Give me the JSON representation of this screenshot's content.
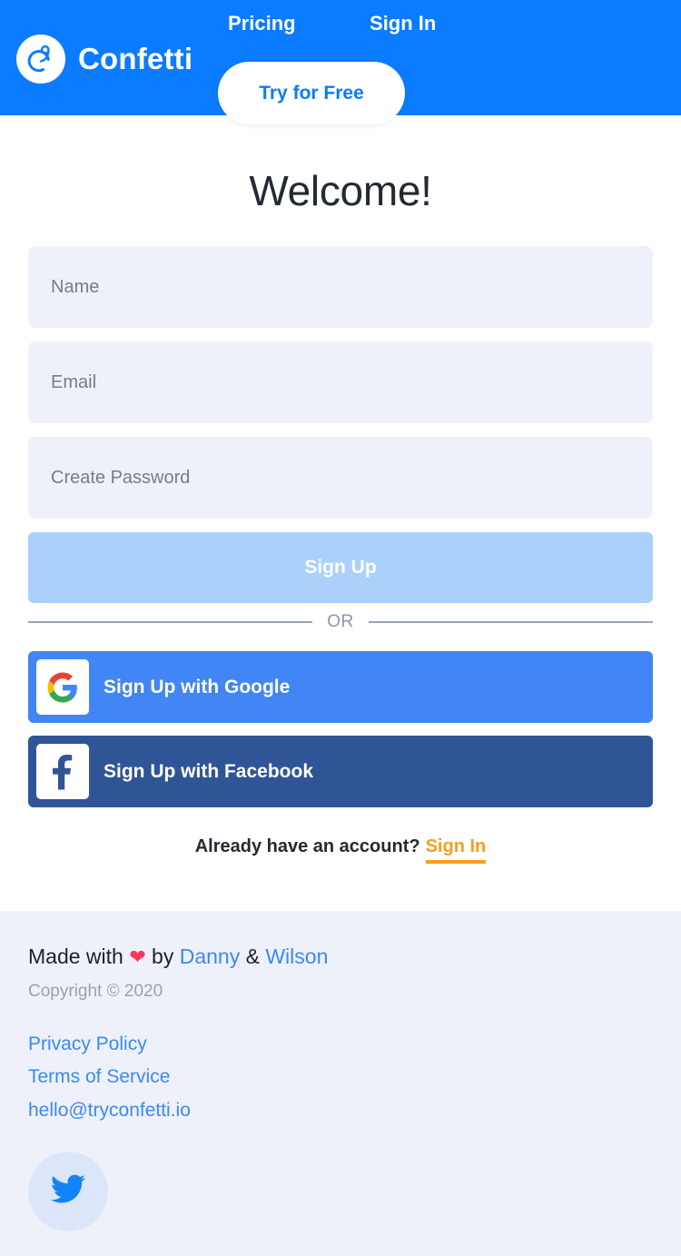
{
  "header": {
    "brand_name": "Confetti",
    "brand_logo_icon": "confetti-swirl-icon",
    "nav": [
      {
        "label": "Pricing",
        "name": "pricing"
      },
      {
        "label": "Sign In",
        "name": "sign-in"
      }
    ],
    "cta_label": "Try for Free",
    "background_color": "#0b7bff",
    "cta_text_color": "#0b7bff"
  },
  "main": {
    "title": "Welcome!",
    "fields": [
      {
        "placeholder": "Name",
        "value": "",
        "type": "text"
      },
      {
        "placeholder": "Email",
        "value": "",
        "type": "email"
      },
      {
        "placeholder": "Create Password",
        "value": "",
        "type": "password"
      }
    ],
    "submit_label": "Sign Up",
    "divider_label": "OR",
    "social": [
      {
        "label": "Sign Up with Google",
        "icon": "google-icon",
        "color": "#4285f4"
      },
      {
        "label": "Sign Up with Facebook",
        "icon": "facebook-icon",
        "color": "#2f5596"
      }
    ],
    "have_account_text": "Already have an account?",
    "have_account_link": "Sign In",
    "link_color": "#f89d1c"
  },
  "footer": {
    "made_with_prefix": "Made with",
    "made_with_heart": "❤",
    "made_with_by": "by",
    "author_one": "Danny",
    "author_joiner": "&",
    "author_two": "Wilson",
    "copyright": "Copyright © 2020",
    "links": [
      {
        "label": "Privacy Policy",
        "name": "privacy-policy"
      },
      {
        "label": "Terms of Service",
        "name": "terms-of-service"
      },
      {
        "label": "hello@tryconfetti.io",
        "name": "email-contact"
      }
    ],
    "social_icon": "twitter-icon",
    "background_color": "#eef1fa"
  }
}
